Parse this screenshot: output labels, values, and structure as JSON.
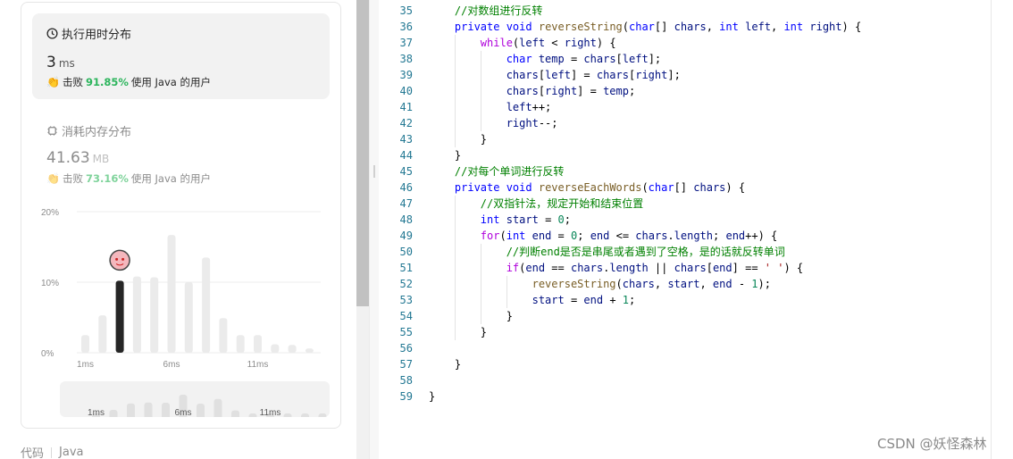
{
  "runtime": {
    "title": "执行用时分布",
    "icon": "clock-icon",
    "value": "3",
    "unit": "ms",
    "beat_prefix": "击败",
    "beat_pct": "91.85%",
    "beat_suffix": "使用 Java 的用户"
  },
  "memory": {
    "title": "消耗内存分布",
    "icon": "chip-icon",
    "value": "41.63",
    "unit": "MB",
    "beat_prefix": "击败",
    "beat_pct": "73.16%",
    "beat_suffix": "使用 Java 的用户"
  },
  "footer": {
    "label": "代码",
    "language": "Java"
  },
  "colors": {
    "accent_green": "#2db55d",
    "bar_gray": "#ebebeb",
    "bar_active": "#262626"
  },
  "chart_data": {
    "type": "bar",
    "y_ticks": [
      "20%",
      "10%",
      "0%"
    ],
    "ylim": [
      0,
      20
    ],
    "x_tick_labels": [
      "1ms",
      "6ms",
      "11ms"
    ],
    "x_tick_indices": [
      0,
      5,
      10
    ],
    "values": [
      2.5,
      5.3,
      10.2,
      10.8,
      10.7,
      16.7,
      10.0,
      13.5,
      4.9,
      2.5,
      2.5,
      1.2,
      1.1,
      0.6
    ],
    "highlight_index": 2,
    "minimap_values": [
      2.5,
      5.3,
      10.2,
      10.8,
      10.7,
      16.7,
      10.0,
      13.5,
      4.9,
      2.5,
      2.5,
      1.2,
      1.1,
      0.6
    ],
    "grid": true
  },
  "code_lines": [
    {
      "n": "35",
      "indent": 1,
      "tokens": [
        [
          "cm",
          "//对数组进行反转"
        ]
      ]
    },
    {
      "n": "36",
      "indent": 1,
      "tokens": [
        [
          "kw",
          "private"
        ],
        [
          "",
          " "
        ],
        [
          "kw",
          "void"
        ],
        [
          "",
          " "
        ],
        [
          "fn",
          "reverseString"
        ],
        [
          "",
          "("
        ],
        [
          "kw",
          "char"
        ],
        [
          "",
          "[] "
        ],
        [
          "va",
          "chars"
        ],
        [
          "",
          ", "
        ],
        [
          "kw",
          "int"
        ],
        [
          "",
          " "
        ],
        [
          "va",
          "left"
        ],
        [
          "",
          ", "
        ],
        [
          "kw",
          "int"
        ],
        [
          "",
          " "
        ],
        [
          "va",
          "right"
        ],
        [
          "",
          ") {"
        ]
      ]
    },
    {
      "n": "37",
      "indent": 2,
      "tokens": [
        [
          "kc",
          "while"
        ],
        [
          "",
          "("
        ],
        [
          "va",
          "left"
        ],
        [
          "",
          " < "
        ],
        [
          "va",
          "right"
        ],
        [
          "",
          ") {"
        ]
      ]
    },
    {
      "n": "38",
      "indent": 3,
      "tokens": [
        [
          "kw",
          "char"
        ],
        [
          "",
          " "
        ],
        [
          "va",
          "temp"
        ],
        [
          "",
          " = "
        ],
        [
          "va",
          "chars"
        ],
        [
          "",
          "["
        ],
        [
          "va",
          "left"
        ],
        [
          "",
          "];"
        ]
      ]
    },
    {
      "n": "39",
      "indent": 3,
      "tokens": [
        [
          "va",
          "chars"
        ],
        [
          "",
          "["
        ],
        [
          "va",
          "left"
        ],
        [
          "",
          "] = "
        ],
        [
          "va",
          "chars"
        ],
        [
          "",
          "["
        ],
        [
          "va",
          "right"
        ],
        [
          "",
          "];"
        ]
      ]
    },
    {
      "n": "40",
      "indent": 3,
      "tokens": [
        [
          "va",
          "chars"
        ],
        [
          "",
          "["
        ],
        [
          "va",
          "right"
        ],
        [
          "",
          "] = "
        ],
        [
          "va",
          "temp"
        ],
        [
          "",
          ";"
        ]
      ]
    },
    {
      "n": "41",
      "indent": 3,
      "tokens": [
        [
          "va",
          "left"
        ],
        [
          "",
          "++;"
        ]
      ]
    },
    {
      "n": "42",
      "indent": 3,
      "tokens": [
        [
          "va",
          "right"
        ],
        [
          "",
          "--;"
        ]
      ]
    },
    {
      "n": "43",
      "indent": 2,
      "tokens": [
        [
          "",
          "}"
        ]
      ]
    },
    {
      "n": "44",
      "indent": 1,
      "tokens": [
        [
          "",
          "}"
        ]
      ]
    },
    {
      "n": "45",
      "indent": 1,
      "tokens": [
        [
          "cm",
          "//对每个单词进行反转"
        ]
      ]
    },
    {
      "n": "46",
      "indent": 1,
      "tokens": [
        [
          "kw",
          "private"
        ],
        [
          "",
          " "
        ],
        [
          "kw",
          "void"
        ],
        [
          "",
          " "
        ],
        [
          "fn",
          "reverseEachWords"
        ],
        [
          "",
          "("
        ],
        [
          "kw",
          "char"
        ],
        [
          "",
          "[] "
        ],
        [
          "va",
          "chars"
        ],
        [
          "",
          ") {"
        ]
      ]
    },
    {
      "n": "47",
      "indent": 2,
      "tokens": [
        [
          "cm",
          "//双指针法，规定开始和结束位置"
        ]
      ]
    },
    {
      "n": "48",
      "indent": 2,
      "tokens": [
        [
          "kw",
          "int"
        ],
        [
          "",
          " "
        ],
        [
          "va",
          "start"
        ],
        [
          "",
          " = "
        ],
        [
          "nu",
          "0"
        ],
        [
          "",
          ";"
        ]
      ]
    },
    {
      "n": "49",
      "indent": 2,
      "tokens": [
        [
          "kc",
          "for"
        ],
        [
          "",
          "("
        ],
        [
          "kw",
          "int"
        ],
        [
          "",
          " "
        ],
        [
          "va",
          "end"
        ],
        [
          "",
          " = "
        ],
        [
          "nu",
          "0"
        ],
        [
          "",
          "; "
        ],
        [
          "va",
          "end"
        ],
        [
          "",
          " <= "
        ],
        [
          "va",
          "chars"
        ],
        [
          "",
          "."
        ],
        [
          "va",
          "length"
        ],
        [
          "",
          "; "
        ],
        [
          "va",
          "end"
        ],
        [
          "",
          "++) {"
        ]
      ]
    },
    {
      "n": "50",
      "indent": 3,
      "tokens": [
        [
          "cm",
          "//判断end是否是串尾或者遇到了空格，是的话就反转单词"
        ]
      ]
    },
    {
      "n": "51",
      "indent": 3,
      "tokens": [
        [
          "kc",
          "if"
        ],
        [
          "",
          "("
        ],
        [
          "va",
          "end"
        ],
        [
          "",
          " == "
        ],
        [
          "va",
          "chars"
        ],
        [
          "",
          "."
        ],
        [
          "va",
          "length"
        ],
        [
          "",
          " || "
        ],
        [
          "va",
          "chars"
        ],
        [
          "",
          "["
        ],
        [
          "va",
          "end"
        ],
        [
          "",
          "] == "
        ],
        [
          "st",
          "' '"
        ],
        [
          "",
          ") {"
        ]
      ]
    },
    {
      "n": "52",
      "indent": 4,
      "tokens": [
        [
          "fn",
          "reverseString"
        ],
        [
          "",
          "("
        ],
        [
          "va",
          "chars"
        ],
        [
          "",
          ", "
        ],
        [
          "va",
          "start"
        ],
        [
          "",
          ", "
        ],
        [
          "va",
          "end"
        ],
        [
          "",
          " - "
        ],
        [
          "nu",
          "1"
        ],
        [
          "",
          ");"
        ]
      ]
    },
    {
      "n": "53",
      "indent": 4,
      "tokens": [
        [
          "va",
          "start"
        ],
        [
          "",
          " = "
        ],
        [
          "va",
          "end"
        ],
        [
          "",
          " + "
        ],
        [
          "nu",
          "1"
        ],
        [
          "",
          ";"
        ]
      ]
    },
    {
      "n": "54",
      "indent": 3,
      "tokens": [
        [
          "",
          "}"
        ]
      ]
    },
    {
      "n": "55",
      "indent": 2,
      "tokens": [
        [
          "",
          "}"
        ]
      ]
    },
    {
      "n": "56",
      "indent": 0,
      "tokens": []
    },
    {
      "n": "57",
      "indent": 1,
      "tokens": [
        [
          "",
          "}"
        ]
      ]
    },
    {
      "n": "58",
      "indent": 0,
      "tokens": []
    },
    {
      "n": "59",
      "indent": 0,
      "tokens": [
        [
          "",
          "}"
        ]
      ]
    }
  ],
  "watermark": "CSDN @妖怪森林"
}
